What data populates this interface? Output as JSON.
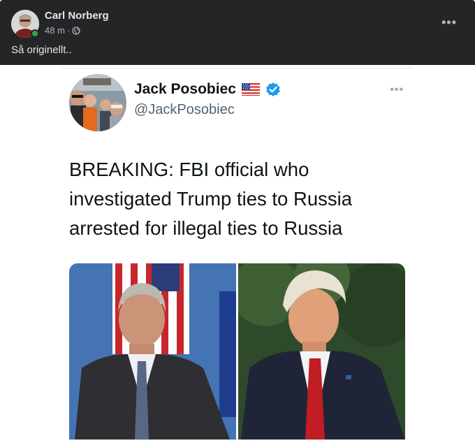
{
  "facebook_post": {
    "author": "Carl Norberg",
    "timestamp": "48 m",
    "separator": "·",
    "privacy_icon": "globe-icon",
    "more_icon": "more-options-icon",
    "more_label": "•••",
    "text": "Så originellt.."
  },
  "tweet": {
    "display_name": "Jack Posobiec",
    "flag_icon": "us-flag-icon",
    "verified_icon": "verified-badge-icon",
    "handle": "@JackPosobiec",
    "more_label": "•••",
    "text": "BREAKING: FBI official who investigated Trump ties to Russia arrested for illegal ties to Russia",
    "media": {
      "left_photo": "man-in-suit-with-flag-photo",
      "right_photo": "man-in-suit-outdoors-photo"
    }
  },
  "colors": {
    "fb_background": "#242526",
    "fb_text": "#e4e6eb",
    "fb_secondary": "#b0b3b8",
    "online_green": "#31a24c",
    "twitter_blue": "#1d9bf0"
  }
}
